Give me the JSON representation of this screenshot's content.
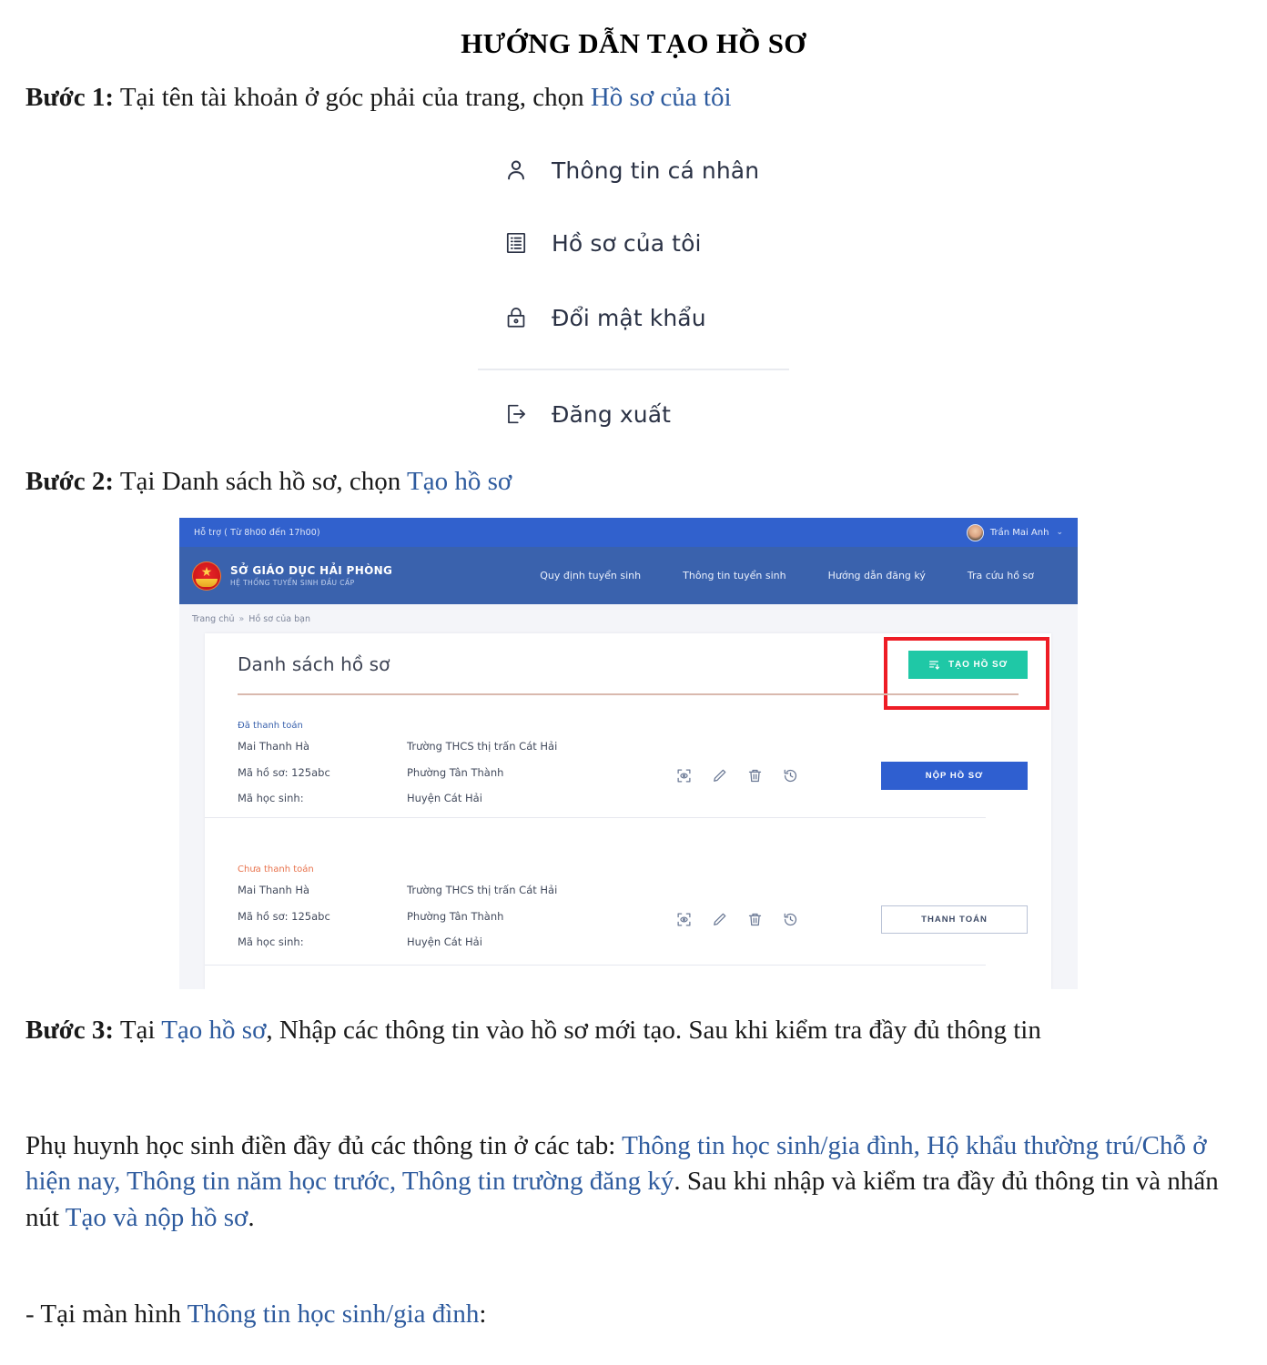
{
  "document": {
    "title": "HƯỚNG DẪN TẠO HỒ SƠ",
    "step1": {
      "label": "Bước 1:",
      "text_before": " Tại tên tài khoản ở góc phải của trang, chọn ",
      "link": "Hồ sơ của tôi"
    },
    "step2": {
      "label": "Bước 2:",
      "text_before": " Tại Danh sách hồ sơ, chọn ",
      "link": "Tạo hồ sơ"
    },
    "step3": {
      "label": "Bước 3:",
      "text_a": " Tại ",
      "link_a": "Tạo hồ sơ",
      "text_b": ", Nhập các thông tin vào hồ sơ mới tạo. Sau khi kiểm tra đầy đủ thông tin"
    },
    "para_tabs": {
      "text_a": "Phụ huynh học sinh điền đầy đủ các thông tin ở các tab: ",
      "link_a": "Thông tin học sinh/gia đình, Hộ khẩu thường trú/Chỗ ở hiện nay, Thông tin năm học trước, Thông tin trường đăng ký",
      "text_b": ". Sau khi nhập và kiểm tra đầy đủ thông tin và nhấn nút ",
      "link_b": "Tạo và nộp hồ sơ",
      "text_c": "."
    },
    "para_screen": {
      "text_a": "- Tại màn hình ",
      "link_a": "Thông tin học sinh/gia đình",
      "text_b": ":"
    }
  },
  "account_menu": {
    "items": [
      {
        "icon": "user-icon",
        "label": "Thông tin cá nhân"
      },
      {
        "icon": "document-list-icon",
        "label": "Hồ sơ của tôi"
      },
      {
        "icon": "lock-icon",
        "label": "Đổi mật khẩu"
      },
      {
        "icon": "logout-icon",
        "label": "Đăng xuất"
      }
    ]
  },
  "app_screenshot": {
    "topbar": {
      "support": "Hỗ trợ ( Từ 8h00 đến 17h00)",
      "user_name": "Trần Mai Anh",
      "caret": "⌄"
    },
    "brand": {
      "main": "SỞ GIÁO DỤC HẢI PHÒNG",
      "sub": "HỆ THỐNG TUYỂN SINH ĐẦU CẤP"
    },
    "nav": [
      "Quy định tuyển sinh",
      "Thông tin tuyển sinh",
      "Hướng dẫn đăng ký",
      "Tra cứu hồ sơ"
    ],
    "breadcrumb": {
      "home": "Trang chủ",
      "separator": "»",
      "current": "Hồ sơ của bạn"
    },
    "list_title": "Danh sách hồ sơ",
    "create_button": "TẠO HỒ SƠ",
    "records": [
      {
        "status": "Đã thanh toán",
        "status_type": "paid",
        "name": "Mai Thanh Hà",
        "profile_code": "Mã hồ sơ: 125abc",
        "student_code": "Mã học sinh:",
        "school": "Trường THCS thị trấn Cát Hải",
        "ward": "Phường Tân Thành",
        "district": "Huyện Cát Hải",
        "cta": "NỘP HỒ SƠ",
        "cta_type": "filled"
      },
      {
        "status": "Chưa thanh toán",
        "status_type": "unpaid",
        "name": "Mai Thanh Hà",
        "profile_code": "Mã hồ sơ: 125abc",
        "student_code": "Mã học sinh:",
        "school": "Trường THCS thị trấn Cát Hải",
        "ward": "Phường Tân Thành",
        "district": "Huyện Cát Hải",
        "cta": "THANH TOÁN",
        "cta_type": "outline"
      }
    ],
    "row_icons": [
      "scan-icon",
      "edit-icon",
      "delete-icon",
      "history-icon"
    ],
    "colors": {
      "topbar": "#3161cd",
      "header": "#3a62ad",
      "create_button": "#1fc8a6",
      "submit_button": "#2f5fd0",
      "highlight_border": "#ee1c25",
      "status_paid": "#3a62ad",
      "status_unpaid": "#e8724c",
      "doc_link": "#2e5b9e"
    }
  }
}
